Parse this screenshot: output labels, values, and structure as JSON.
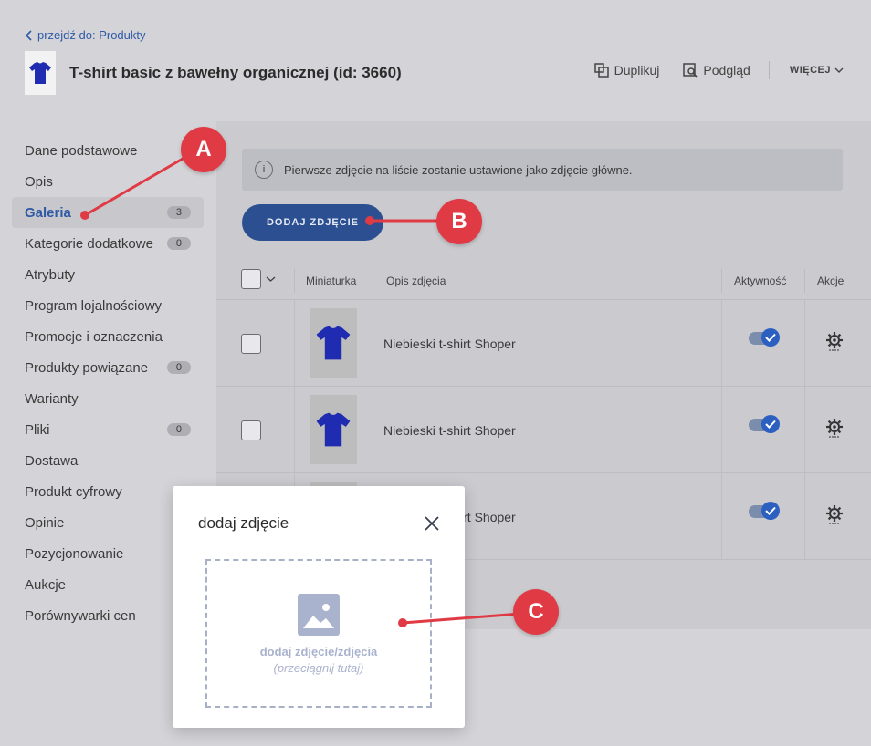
{
  "header": {
    "back_link": "przejdź do: Produkty",
    "title": "T-shirt basic z bawełny organicznej (id: 3660)",
    "actions": {
      "duplicate": "Duplikuj",
      "preview": "Podgląd",
      "more": "WIĘCEJ"
    }
  },
  "sidebar": {
    "items": [
      {
        "label": "Dane podstawowe",
        "badge": ""
      },
      {
        "label": "Opis",
        "badge": ""
      },
      {
        "label": "Galeria",
        "badge": "3"
      },
      {
        "label": "Kategorie dodatkowe",
        "badge": "0"
      },
      {
        "label": "Atrybuty",
        "badge": ""
      },
      {
        "label": "Program lojalnościowy",
        "badge": ""
      },
      {
        "label": "Promocje i oznaczenia",
        "badge": ""
      },
      {
        "label": "Produkty powiązane",
        "badge": "0"
      },
      {
        "label": "Warianty",
        "badge": ""
      },
      {
        "label": "Pliki",
        "badge": "0"
      },
      {
        "label": "Dostawa",
        "badge": ""
      },
      {
        "label": "Produkt cyfrowy",
        "badge": ""
      },
      {
        "label": "Opinie",
        "badge": ""
      },
      {
        "label": "Pozycjonowanie",
        "badge": ""
      },
      {
        "label": "Aukcje",
        "badge": ""
      },
      {
        "label": "Porównywarki cen",
        "badge": ""
      }
    ],
    "active_index": 2
  },
  "gallery": {
    "info_text": "Pierwsze zdjęcie na liście zostanie ustawione jako zdjęcie główne.",
    "add_button": "DODAJ ZDJĘCIE",
    "columns": {
      "thumbnail": "Miniaturka",
      "description": "Opis zdjęcia",
      "active": "Aktywność",
      "actions": "Akcje"
    },
    "rows": [
      {
        "description": "Niebieski t-shirt Shoper",
        "active": true
      },
      {
        "description": "Niebieski t-shirt Shoper",
        "active": true
      },
      {
        "description": "Niebieski t-shirt Shoper",
        "active": true
      }
    ]
  },
  "modal": {
    "title": "dodaj zdjęcie",
    "dropzone_label": "dodaj zdjęcie/zdjęcia",
    "dropzone_hint": "(przeciągnij tutaj)"
  },
  "annotations": {
    "a": "A",
    "b": "B",
    "c": "C"
  },
  "colors": {
    "accent": "#2c4f91",
    "annotation": "#e03a45",
    "toggle_on": "#2b5fc0"
  }
}
